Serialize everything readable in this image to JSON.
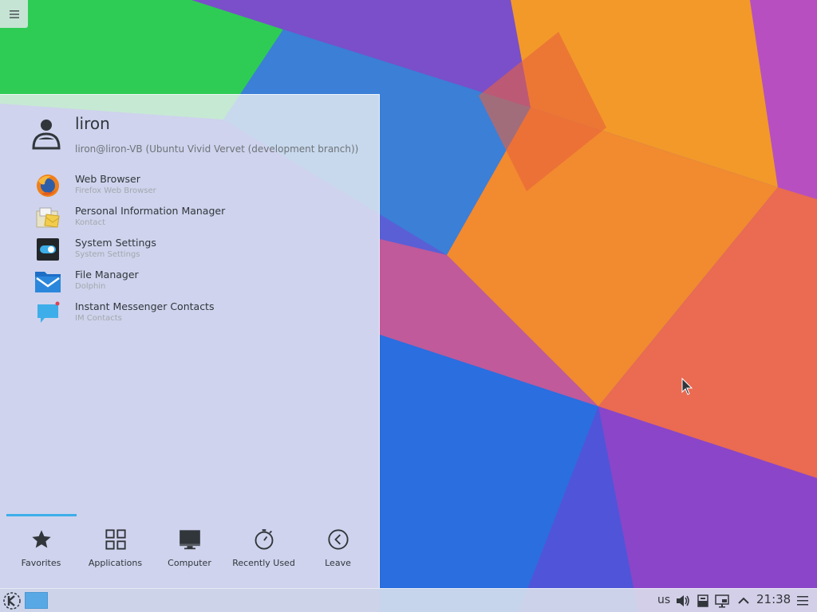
{
  "desktop": {
    "toolbox_icon": "hamburger-menu-icon"
  },
  "launcher": {
    "user": {
      "name": "liron",
      "host": "liron@liron-VB (Ubuntu Vivid Vervet (development branch))",
      "avatar_icon": "user-avatar-icon"
    },
    "favorites": [
      {
        "name": "Web Browser",
        "desc": "Firefox Web Browser",
        "icon": "firefox-icon"
      },
      {
        "name": "Personal Information Manager",
        "desc": "Kontact",
        "icon": "kontact-icon"
      },
      {
        "name": "System Settings",
        "desc": "System Settings",
        "icon": "system-settings-icon"
      },
      {
        "name": "File Manager",
        "desc": "Dolphin",
        "icon": "dolphin-folder-icon"
      },
      {
        "name": "Instant Messenger Contacts",
        "desc": "IM Contacts",
        "icon": "im-chat-icon"
      }
    ],
    "tabs": [
      {
        "label": "Favorites",
        "icon": "star-icon",
        "active": true
      },
      {
        "label": "Applications",
        "icon": "grid-icon"
      },
      {
        "label": "Computer",
        "icon": "monitor-icon"
      },
      {
        "label": "Recently Used",
        "icon": "clock-icon"
      },
      {
        "label": "Leave",
        "icon": "arrow-left-circle-icon"
      }
    ],
    "accent": "#3daee9"
  },
  "panel": {
    "keyboard_layout": "us",
    "clock": "21:38",
    "tray_icons": [
      "volume-icon",
      "device-notifier-icon",
      "display-icon",
      "expand-tray-icon"
    ],
    "launcher_icon": "kde-logo-icon",
    "menu_icon": "panel-menu-icon"
  }
}
